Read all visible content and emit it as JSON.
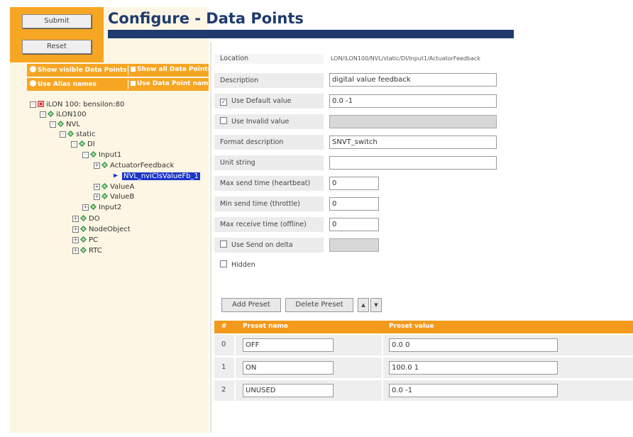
{
  "header": {
    "title": "Configure - Data Points"
  },
  "actions": {
    "submit_label": "Submit",
    "reset_label": "Reset"
  },
  "options": {
    "show_visible_label": "Show visible Data Points",
    "show_all_label": "Show all Data Points",
    "use_alias_label": "Use Alias names",
    "use_dp_names_label": "Use Data Point names"
  },
  "tree": [
    {
      "label": "iLON 100: bensilon:80",
      "expander": "-",
      "icon": "device-icon"
    },
    {
      "label": "iLON100",
      "expander": "-",
      "icon": "node-diamond-icon"
    },
    {
      "label": "NVL",
      "expander": "-",
      "icon": "node-diamond-icon"
    },
    {
      "label": "static",
      "expander": "-",
      "icon": "node-diamond-icon"
    },
    {
      "label": "DI",
      "expander": "-",
      "icon": "node-diamond-icon"
    },
    {
      "label": "Input1",
      "expander": "-",
      "icon": "node-diamond-icon"
    },
    {
      "label": "ActuatorFeedback",
      "expander": "+",
      "icon": "node-diamond-icon"
    },
    {
      "label": "NVL_nviClsValueFb_1",
      "expander": "",
      "icon": "arrow-icon",
      "selected": true
    },
    {
      "label": "ValueA",
      "expander": "+",
      "icon": "node-diamond-icon"
    },
    {
      "label": "ValueB",
      "expander": "+",
      "icon": "node-diamond-icon"
    },
    {
      "label": "Input2",
      "expander": "+",
      "icon": "node-diamond-icon"
    },
    {
      "label": "DO",
      "expander": "+",
      "icon": "node-diamond-icon"
    },
    {
      "label": "NodeObject",
      "expander": "+",
      "icon": "node-diamond-icon"
    },
    {
      "label": "PC",
      "expander": "+",
      "icon": "node-diamond-icon"
    },
    {
      "label": "RTC",
      "expander": "+",
      "icon": "node-diamond-icon"
    }
  ],
  "form": {
    "location_label": "Location",
    "location_value": "LON/iLON100/NVL/static/DI/Input1/ActuatorFeedback",
    "description_label": "Description",
    "description_value": "digital value feedback",
    "use_default_label": "Use Default value",
    "default_value": "0.0 -1",
    "use_invalid_label": "Use Invalid value",
    "format_label": "Format description",
    "format_value": "SNVT_switch",
    "unit_label": "Unit string",
    "unit_value": "",
    "max_send_label": "Max send time (heartbeat)",
    "max_send_value": "0",
    "min_send_label": "Min send time (throttle)",
    "min_send_value": "0",
    "max_receive_label": "Max receive time (offline)",
    "max_receive_value": "0",
    "use_send_delta_label": "Use Send on delta",
    "hidden_label": "Hidden"
  },
  "presets": {
    "add_label": "Add Preset",
    "delete_label": "Delete Preset",
    "up_glyph": "▲",
    "down_glyph": "▼",
    "col_index": "#",
    "col_name": "Preset name",
    "col_value": "Preset value",
    "rows": [
      {
        "index": "0",
        "name": "OFF",
        "value": "0.0 0"
      },
      {
        "index": "1",
        "name": "ON",
        "value": "100.0 1"
      },
      {
        "index": "2",
        "name": "UNUSED",
        "value": "0.0 -1"
      }
    ]
  },
  "colors": {
    "orange": "#f6a623",
    "navy": "#1f3a6e",
    "selected": "#1c35c9"
  }
}
